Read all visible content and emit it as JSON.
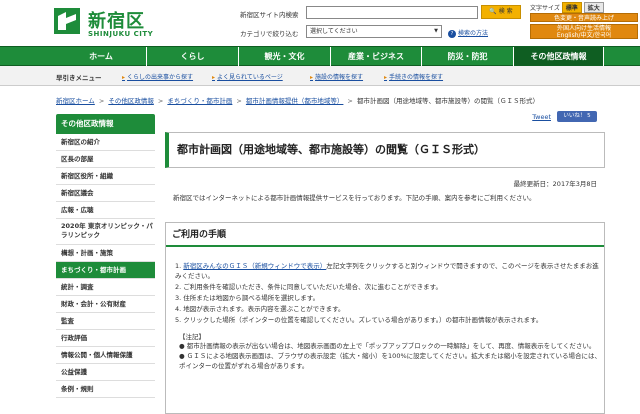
{
  "header": {
    "logo_text": "新宿区",
    "logo_sub": "SHINJUKU CITY",
    "search_label": "新宿区サイト内検索",
    "search_button": "検 索",
    "category_label": "カテゴリで絞り込む",
    "category_select": "選択してください",
    "help_link": "検索の方法",
    "text_size_label": "文字サイズ",
    "text_size_standard": "標準",
    "text_size_large": "拡大",
    "color_voice": "色変更・音声読み上げ",
    "foreign_title": "外国人向け生活情報",
    "foreign_langs": "English/中文/한국어"
  },
  "mainnav": [
    {
      "label": "ホーム"
    },
    {
      "label": "くらし"
    },
    {
      "label": "観光・文化"
    },
    {
      "label": "産業・ビジネス"
    },
    {
      "label": "防災・防犯"
    },
    {
      "label": "その他区政情報"
    }
  ],
  "subnav": {
    "label": "早引きメニュー",
    "items": [
      {
        "label": "くらしの出来事から探す"
      },
      {
        "label": "よく見られているページ"
      },
      {
        "label": "施設の情報を探す"
      },
      {
        "label": "手続きの情報を探す"
      }
    ]
  },
  "breadcrumb": [
    {
      "label": "新宿区ホーム"
    },
    {
      "label": "その他区政情報"
    },
    {
      "label": "まちづくり・都市計画"
    },
    {
      "label": "都市計画情報提供（都市地域等）"
    }
  ],
  "breadcrumb_current": "都市計画図（用途地域等、都市施設等）の閲覧（ＧＩＳ形式）",
  "sidebar": {
    "head": "その他区政情報",
    "items": [
      {
        "label": "新宿区の紹介"
      },
      {
        "label": "区長の部屋"
      },
      {
        "label": "新宿区役所・組織"
      },
      {
        "label": "新宿区議会"
      },
      {
        "label": "広報・広聴"
      },
      {
        "label": "2020年 東京オリンピック・パラリンピック"
      },
      {
        "label": "構想・計画・施策"
      },
      {
        "label": "まちづくり・都市計画"
      },
      {
        "label": "統計・調査"
      },
      {
        "label": "財政・会計・公有財産"
      },
      {
        "label": "監査"
      },
      {
        "label": "行政評価"
      },
      {
        "label": "情報公開・個人情報保護"
      },
      {
        "label": "公益保護"
      },
      {
        "label": "条例・規則"
      }
    ]
  },
  "share": {
    "tweet": "Tweet",
    "like": "いいね！ 5"
  },
  "page": {
    "title": "都市計画図（用途地域等、都市施設等）の閲覧（ＧＩＳ形式）",
    "updated": "最終更新日：2017年3月8日",
    "intro": "新宿区ではインターネットによる都市計画情報提供サービスを行っております。下記の手順、案内を参考にご利用ください。"
  },
  "section": {
    "title": "ご利用の手順",
    "step1_pre": "1. ",
    "step1_link": "新宿区みんなのＧＩＳ（新規ウィンドウで表示）",
    "step1_post": "左記文字列をクリックすると別ウィンドウで開きますので、このページを表示させたままお進みください。",
    "steps": [
      "2. ご利用条件を確認いただき、条件に同意していただいた場合、次に進むことができます。",
      "3. 住所または地図から調べる場所を選択します。",
      "4. 地図が表示されます。表示内容を選ぶことができます。",
      "5. クリックした場所（ポインターの位置を確認してください。ズレている場合があります。）の都市計画情報が表示されます。"
    ],
    "notes_head": "【注記】",
    "notes": [
      "● 都市計画情報の表示が出ない場合は、地図表示画面の左上で「ポップアップブロックの一時解除」をして、再度、情報表示をしてください。",
      "● ＧＩＳによる地図表示画面は、ブラウザの表示設定（拡大・縮小）を100%に設定してください。拡大または縮小を設定されている場合には、ポインターの位置がずれる場合があります。"
    ]
  },
  "colors": {
    "brand_green": "#1e8c3a",
    "accent_orange": "#e0880f",
    "accent_yellow": "#f3b100"
  }
}
